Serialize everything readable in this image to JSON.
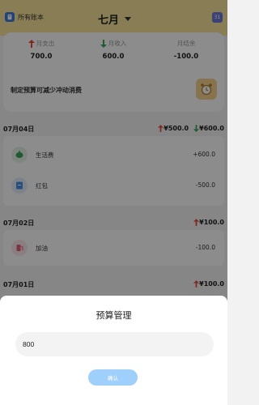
{
  "header": {
    "ledger_label": "所有账本",
    "month_label": "七月",
    "calendar_day": "31"
  },
  "summary": {
    "expense_label": "月支出",
    "expense_value": "700.0",
    "income_label": "月收入",
    "income_value": "600.0",
    "balance_label": "月结余",
    "balance_value": "-100.0",
    "budget_tip": "制定预算可减少冲动消费"
  },
  "days": [
    {
      "date": "07月04日",
      "expense_total": "¥500.0",
      "income_total": "¥600.0",
      "items": [
        {
          "name": "生活费",
          "amount": "+600.0",
          "icon": "piggy-bank-icon"
        },
        {
          "name": "红包",
          "amount": "-500.0",
          "icon": "red-packet-icon"
        }
      ]
    },
    {
      "date": "07月02日",
      "expense_total": "¥100.0",
      "items": [
        {
          "name": "加油",
          "amount": "-100.0",
          "icon": "fuel-icon"
        }
      ]
    },
    {
      "date": "07月01日",
      "expense_total": "¥100.0",
      "items": []
    }
  ],
  "sheet": {
    "title": "预算管理",
    "input_value": "800",
    "confirm_label": "确认"
  },
  "colors": {
    "header_bg": "#f7e49a",
    "expense_red": "#e84a3c",
    "income_green": "#3aa55a",
    "confirm_blue": "#9fd0fb"
  }
}
